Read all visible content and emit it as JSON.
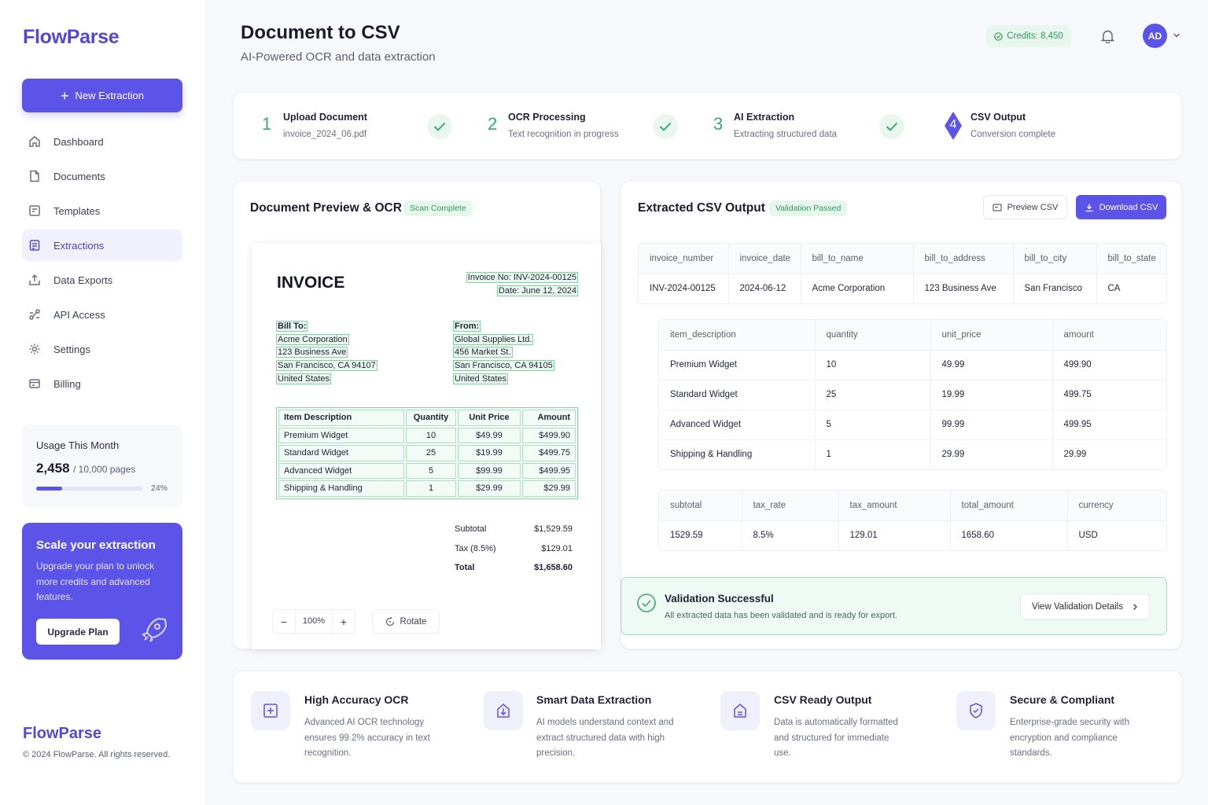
{
  "app": {
    "name": "FlowParse",
    "footer_name": "FlowParse",
    "copyright": "© 2024 FlowParse. All rights reserved."
  },
  "sidebar": {
    "new_button": "New Extraction",
    "items": [
      {
        "label": "Dashboard",
        "icon": "home-icon"
      },
      {
        "label": "Documents",
        "icon": "document-icon"
      },
      {
        "label": "Templates",
        "icon": "template-icon"
      },
      {
        "label": "Extractions",
        "icon": "extraction-icon",
        "active": true
      },
      {
        "label": "Data Exports",
        "icon": "export-icon"
      },
      {
        "label": "API Access",
        "icon": "api-icon"
      },
      {
        "label": "Settings",
        "icon": "gear-icon"
      },
      {
        "label": "Billing",
        "icon": "billing-icon"
      }
    ],
    "usage": {
      "title": "Usage This Month",
      "used": "2,458",
      "total": "/ 10,000 pages",
      "percent_label": "24%",
      "percent": 0.24
    },
    "upgrade": {
      "title": "Scale your extraction",
      "text": "Upgrade your plan to unlock more credits and advanced features.",
      "button": "Upgrade Plan"
    }
  },
  "header": {
    "title": "Document to CSV",
    "subtitle": "AI-Powered OCR and data extraction",
    "credits": "Credits: 8,450",
    "avatar": "AD"
  },
  "steps": [
    {
      "num": "1",
      "title": "Upload Document",
      "sub": "invoice_2024_06.pdf"
    },
    {
      "num": "2",
      "title": "OCR Processing",
      "sub": "Text recognition in progress"
    },
    {
      "num": "3",
      "title": "AI Extraction",
      "sub": "Extracting structured data"
    },
    {
      "num": "4",
      "title": "CSV Output",
      "sub": "Conversion complete"
    }
  ],
  "preview": {
    "title": "Document Preview & OCR",
    "badge": "Scan Complete",
    "zoom": "100%",
    "rotate": "Rotate",
    "invoice": {
      "heading": "INVOICE",
      "number": "Invoice No: INV-2024-00125",
      "date": "Date: June 12, 2024",
      "bill_to": [
        "Bill To:",
        "Acme Corporation",
        "123 Business Ave",
        "San Francisco, CA 94107",
        "United States"
      ],
      "from": [
        "From:",
        "Global Supplies Ltd.",
        "456 Market St.",
        "San Francisco, CA 94105",
        "United States"
      ],
      "columns": [
        "Item Description",
        "Quantity",
        "Unit Price",
        "Amount"
      ],
      "rows": [
        [
          "Premium Widget",
          "10",
          "$49.99",
          "$499.90"
        ],
        [
          "Standard Widget",
          "25",
          "$19.99",
          "$499.75"
        ],
        [
          "Advanced Widget",
          "5",
          "$99.99",
          "$499.95"
        ],
        [
          "Shipping & Handling",
          "1",
          "$29.99",
          "$29.99"
        ]
      ],
      "totals": [
        [
          "Subtotal",
          "$1,529.59"
        ],
        [
          "Tax (8.5%)",
          "$129.01"
        ],
        [
          "Total",
          "$1,658.60"
        ]
      ]
    }
  },
  "output": {
    "title": "Extracted CSV Output",
    "badge": "Validation Passed",
    "preview_button": "Preview CSV",
    "download_button": "Download CSV",
    "header_table": {
      "columns": [
        "invoice_number",
        "invoice_date",
        "bill_to_name",
        "bill_to_address",
        "bill_to_city",
        "bill_to_state"
      ],
      "row": [
        "INV-2024-00125",
        "2024-06-12",
        "Acme Corporation",
        "123 Business Ave",
        "San Francisco",
        "CA"
      ]
    },
    "items_table": {
      "columns": [
        "item_description",
        "quantity",
        "unit_price",
        "amount"
      ],
      "rows": [
        [
          "Premium Widget",
          "10",
          "49.99",
          "499.90"
        ],
        [
          "Standard Widget",
          "25",
          "19.99",
          "499.75"
        ],
        [
          "Advanced Widget",
          "5",
          "99.99",
          "499.95"
        ],
        [
          "Shipping & Handling",
          "1",
          "29.99",
          "29.99"
        ]
      ]
    },
    "totals_table": {
      "columns": [
        "subtotal",
        "tax_rate",
        "tax_amount",
        "total_amount",
        "currency"
      ],
      "row": [
        "1529.59",
        "8.5%",
        "129.01",
        "1658.60",
        "USD"
      ]
    },
    "validation": {
      "title": "Validation Successful",
      "text": "All extracted data has been validated and is ready for export.",
      "button": "View Validation Details"
    }
  },
  "features": [
    {
      "title": "High Accuracy OCR",
      "desc": "Advanced AI OCR technology ensures 99.2% accuracy in text recognition.",
      "icon": "scan-icon"
    },
    {
      "title": "Smart Data Extraction",
      "desc": "AI models understand context and extract structured data with high precision.",
      "icon": "ai-extract-icon"
    },
    {
      "title": "CSV Ready Output",
      "desc": "Data is automatically formatted and structured for immediate use.",
      "icon": "csv-output-icon"
    },
    {
      "title": "Secure & Compliant",
      "desc": "Enterprise-grade security with encryption and compliance standards.",
      "icon": "shield-icon"
    }
  ],
  "colors": {
    "accent": "#5c54e8",
    "success": "#38a96a",
    "success_bg": "#e8f7ee"
  }
}
